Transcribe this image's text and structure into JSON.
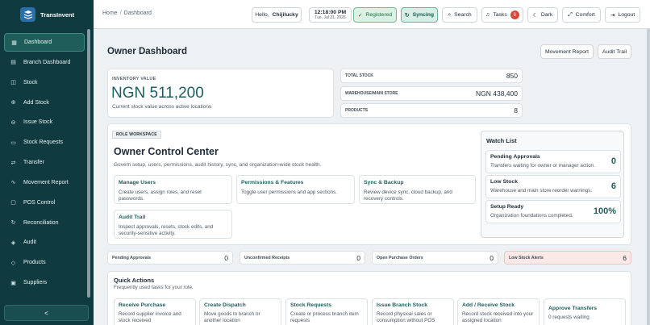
{
  "app": {
    "name": "TransInvent"
  },
  "sidebar": {
    "items": [
      {
        "label": "Dashboard",
        "icon": "grid-icon"
      },
      {
        "label": "Branch Dashboard",
        "icon": "building-icon"
      },
      {
        "label": "Stock",
        "icon": "box-icon"
      },
      {
        "label": "Add Stock",
        "icon": "plus-circle-icon"
      },
      {
        "label": "Issue Stock",
        "icon": "minus-circle-icon"
      },
      {
        "label": "Stock Requests",
        "icon": "clipboard-icon"
      },
      {
        "label": "Transfer",
        "icon": "transfer-icon"
      },
      {
        "label": "Movement Report",
        "icon": "chart-line-icon"
      },
      {
        "label": "POS Control",
        "icon": "monitor-icon"
      },
      {
        "label": "Reconciliation",
        "icon": "refresh-icon"
      },
      {
        "label": "Audit",
        "icon": "shield-icon"
      },
      {
        "label": "Products",
        "icon": "tag-icon"
      },
      {
        "label": "Suppliers",
        "icon": "truck-icon"
      }
    ],
    "collapse_label": "<"
  },
  "header": {
    "breadcrumb_home": "Home",
    "breadcrumb_sep": "/",
    "breadcrumb_current": "Dashboard",
    "hello_prefix": "Hello,",
    "user_name": "Chijilucky",
    "time": "12:18:00 PM",
    "date": "Tue, Jul 21, 2026",
    "registered": "Registered",
    "syncing": "Syncing",
    "search": "Search",
    "tasks": "Tasks",
    "tasks_count": "6",
    "dark": "Dark",
    "comfort": "Comfort",
    "logout": "Logout"
  },
  "page": {
    "title": "Owner Dashboard",
    "movement_report_btn": "Movement Report",
    "audit_trail_btn": "Audit Trail"
  },
  "inventory": {
    "label": "INVENTORY VALUE",
    "value": "NGN 511,200",
    "subtitle": "Current stock value across active locations"
  },
  "kpis": [
    {
      "label": "TOTAL STOCK",
      "value": "850"
    },
    {
      "label": "WAREHOUSE/MAIN STORE",
      "value": "NGN 438,400"
    },
    {
      "label": "PRODUCTS",
      "value": "8"
    }
  ],
  "workspace": {
    "chip": "ROLE WORKSPACE",
    "title": "Owner Control Center",
    "description": "Govern setup, users, permissions, audit history, sync, and organization-wide stock health.",
    "features": [
      {
        "title": "Manage Users",
        "desc": "Create users, assign roles, and reset passwords."
      },
      {
        "title": "Permissions & Features",
        "desc": "Toggle user permissions and app sections."
      },
      {
        "title": "Sync & Backup",
        "desc": "Review device sync, cloud backup, and recovery controls."
      },
      {
        "title": "Audit Trail",
        "desc": "Inspect approvals, resets, stock edits, and security-sensitive activity."
      }
    ]
  },
  "watchlist": {
    "title": "Watch List",
    "rows": [
      {
        "title": "Pending Approvals",
        "desc": "Transfers waiting for owner or manager action.",
        "value": "0"
      },
      {
        "title": "Low Stock",
        "desc": "Warehouse and main store reorder warnings.",
        "value": "6"
      },
      {
        "title": "Setup Ready",
        "desc": "Organization foundations completed.",
        "value": "100%"
      }
    ]
  },
  "stats": [
    {
      "label": "Pending Approvals",
      "value": "0"
    },
    {
      "label": "Unconfirmed Receipts",
      "value": "0"
    },
    {
      "label": "Open Purchase Orders",
      "value": "0"
    },
    {
      "label": "Low Stock Alerts",
      "value": "6"
    }
  ],
  "quick_actions": {
    "title": "Quick Actions",
    "subtitle": "Frequently used tasks for your role.",
    "tiles": [
      {
        "title": "Receive Purchase",
        "desc": "Record supplier invoice and stock received"
      },
      {
        "title": "Create Dispatch",
        "desc": "Move goods to branch or another location"
      },
      {
        "title": "Stock Requests",
        "desc": "Create or process branch item requests"
      },
      {
        "title": "Issue Branch Stock",
        "desc": "Record physical sales or consumption without POS"
      },
      {
        "title": "Add / Receive Stock",
        "desc": "Record stock received into your assigned location"
      },
      {
        "title": "Approve Transfers",
        "desc": "0 requests waiting"
      }
    ]
  },
  "colors": {
    "sidebar_bg": "#0f3a3f",
    "accent": "#1d5f5c",
    "alert": "#d84a3a"
  }
}
